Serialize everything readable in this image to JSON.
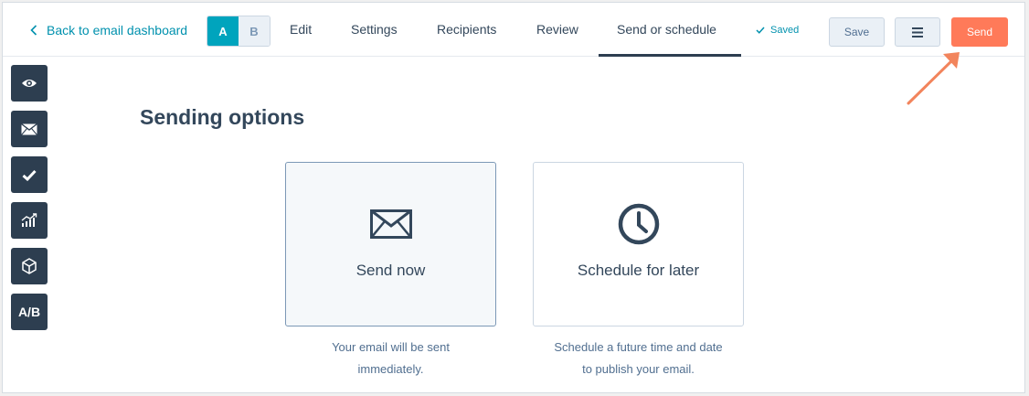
{
  "topbar": {
    "back_label": "Back to email dashboard",
    "ab": {
      "a": "A",
      "b": "B"
    },
    "tabs": [
      "Edit",
      "Settings",
      "Recipients",
      "Review",
      "Send or schedule"
    ],
    "active_tab": "Send or schedule",
    "saved_label": "Saved",
    "save_label": "Save",
    "send_label": "Send"
  },
  "sidebar": {
    "items": [
      "eye-icon",
      "envelope-icon",
      "checkmark-icon",
      "chart-icon",
      "cube-icon",
      "ab-test"
    ],
    "ab_label": "A/B"
  },
  "main": {
    "heading": "Sending options",
    "options": [
      {
        "label": "Send now",
        "icon": "envelope-icon",
        "description_line1": "Your email will be sent",
        "description_line2": "immediately.",
        "selected": true
      },
      {
        "label": "Schedule for later",
        "icon": "clock-icon",
        "description_line1": "Schedule a future time and date",
        "description_line2": "to publish your email.",
        "selected": false
      }
    ]
  },
  "colors": {
    "accent_teal": "#00a4bd",
    "send_orange": "#ff7a59",
    "dark_navy": "#2d3e50",
    "text_slate": "#33475b",
    "arrow": "#f2845c"
  }
}
